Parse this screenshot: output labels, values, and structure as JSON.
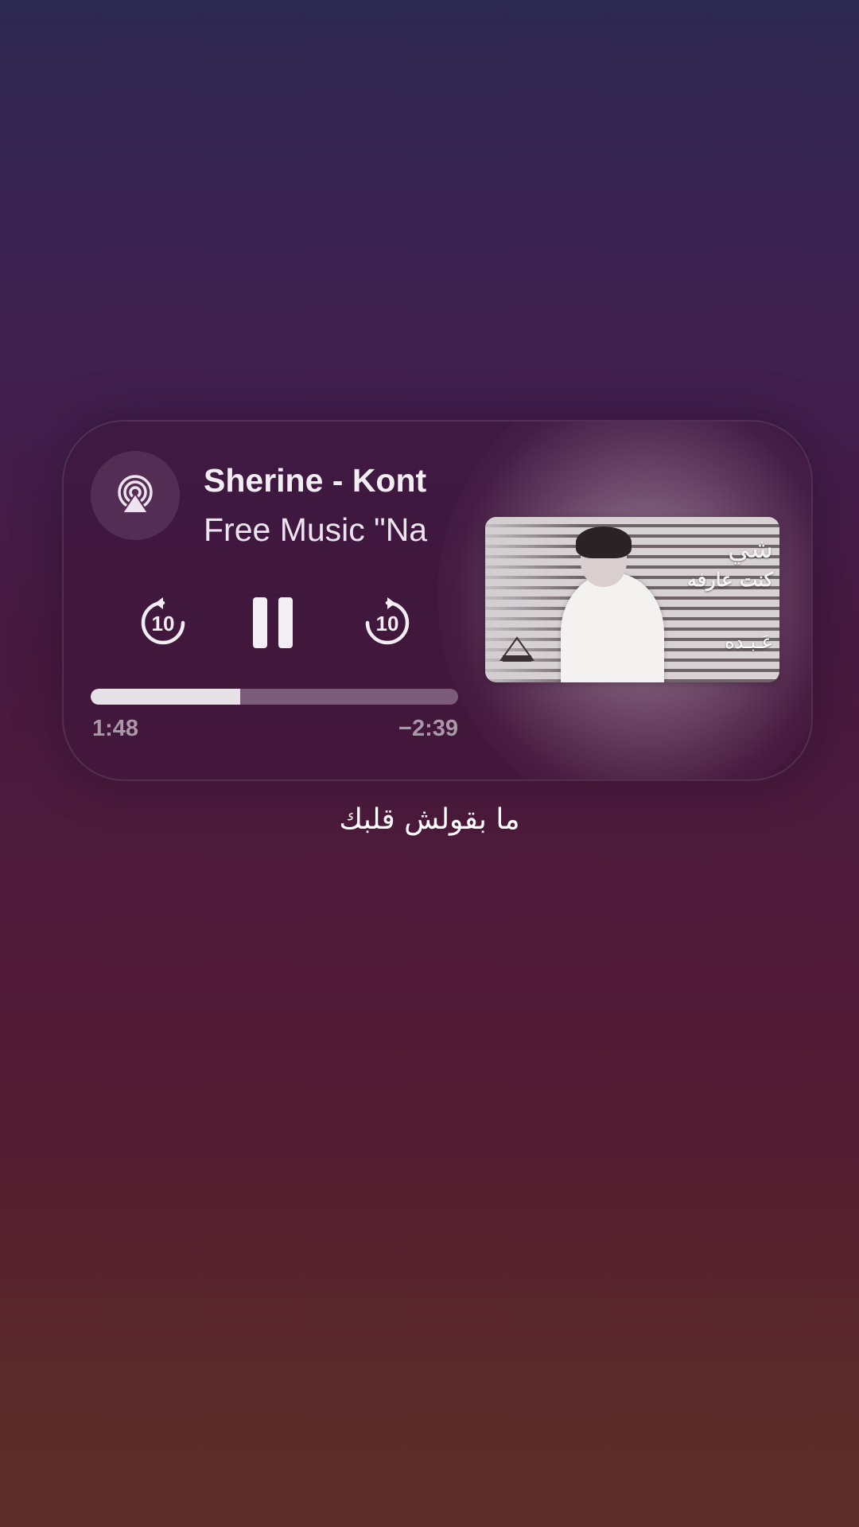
{
  "now_playing": {
    "title": "Sherine - Kont",
    "artist": "Free Music \"Na",
    "progress": 0.408,
    "time_elapsed": "1:48",
    "time_remaining": "−2:39",
    "skip_back_seconds": "10",
    "skip_forward_seconds": "10",
    "icons": {
      "output": "airplay-icon",
      "back": "skip-back-10-icon",
      "play_state": "pause-icon",
      "forward": "skip-forward-10-icon"
    }
  },
  "album_art": {
    "script_top": "شي",
    "script_title": "كنت عارفه",
    "script_bottom": "عَـبـده"
  },
  "lyric": {
    "text": "ما بقولش قلبك"
  },
  "colors": {
    "background_top": "#2d2950",
    "background_mid": "#4b1a3c",
    "background_bottom": "#5c2e29",
    "text_primary": "#f3eef4",
    "text_secondary": "#a898a8",
    "progress_fill": "#e6e2e7"
  }
}
